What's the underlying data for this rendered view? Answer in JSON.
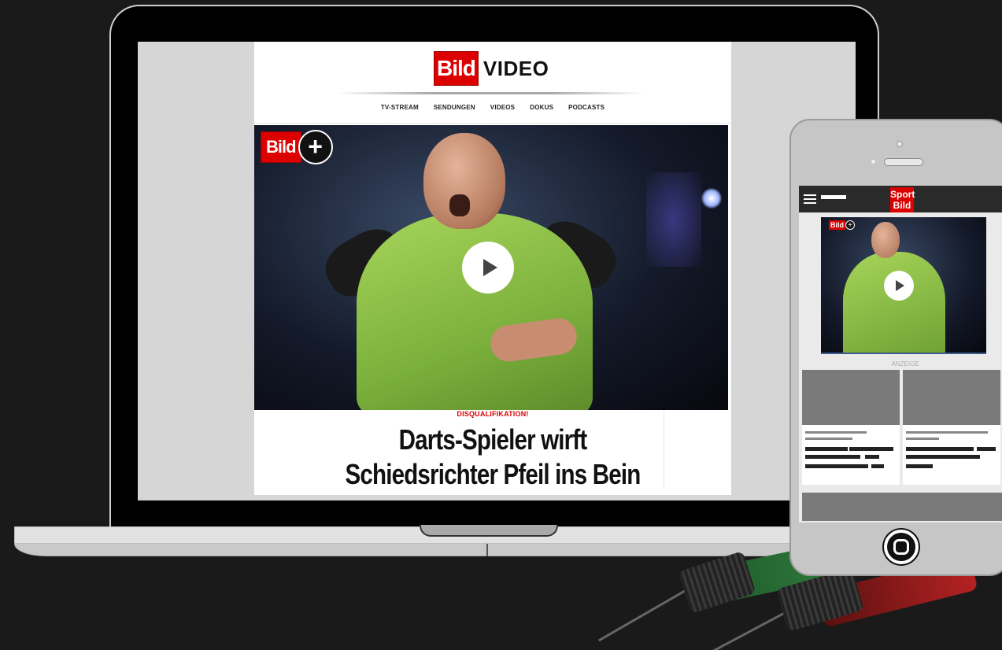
{
  "laptop_site": {
    "logo_text": "Bild",
    "section_title": "VIDEO",
    "nav": [
      "TV-STREAM",
      "SENDUNGEN",
      "VIDEOS",
      "DOKUS",
      "PODCASTS"
    ],
    "hero_badge": {
      "logo_text": "Bild",
      "plus": "+"
    },
    "kicker": "DISQUALIFIKATION!",
    "headline_line1": "Darts-Spieler wirft",
    "headline_line2": "Schiedsrichter Pfeil ins Bein"
  },
  "phone_site": {
    "logo_line1": "Sport",
    "logo_line2": "Bild",
    "hero_badge": {
      "logo_text": "Bild",
      "plus": "+"
    },
    "ad_label": "ANZEIGE"
  },
  "colors": {
    "brand_red": "#dd0000",
    "background": "#1a1a1a",
    "shirt_green": "#a7d55a"
  },
  "icons": [
    "plus-icon",
    "play-icon",
    "menu-icon",
    "home-button-icon"
  ]
}
